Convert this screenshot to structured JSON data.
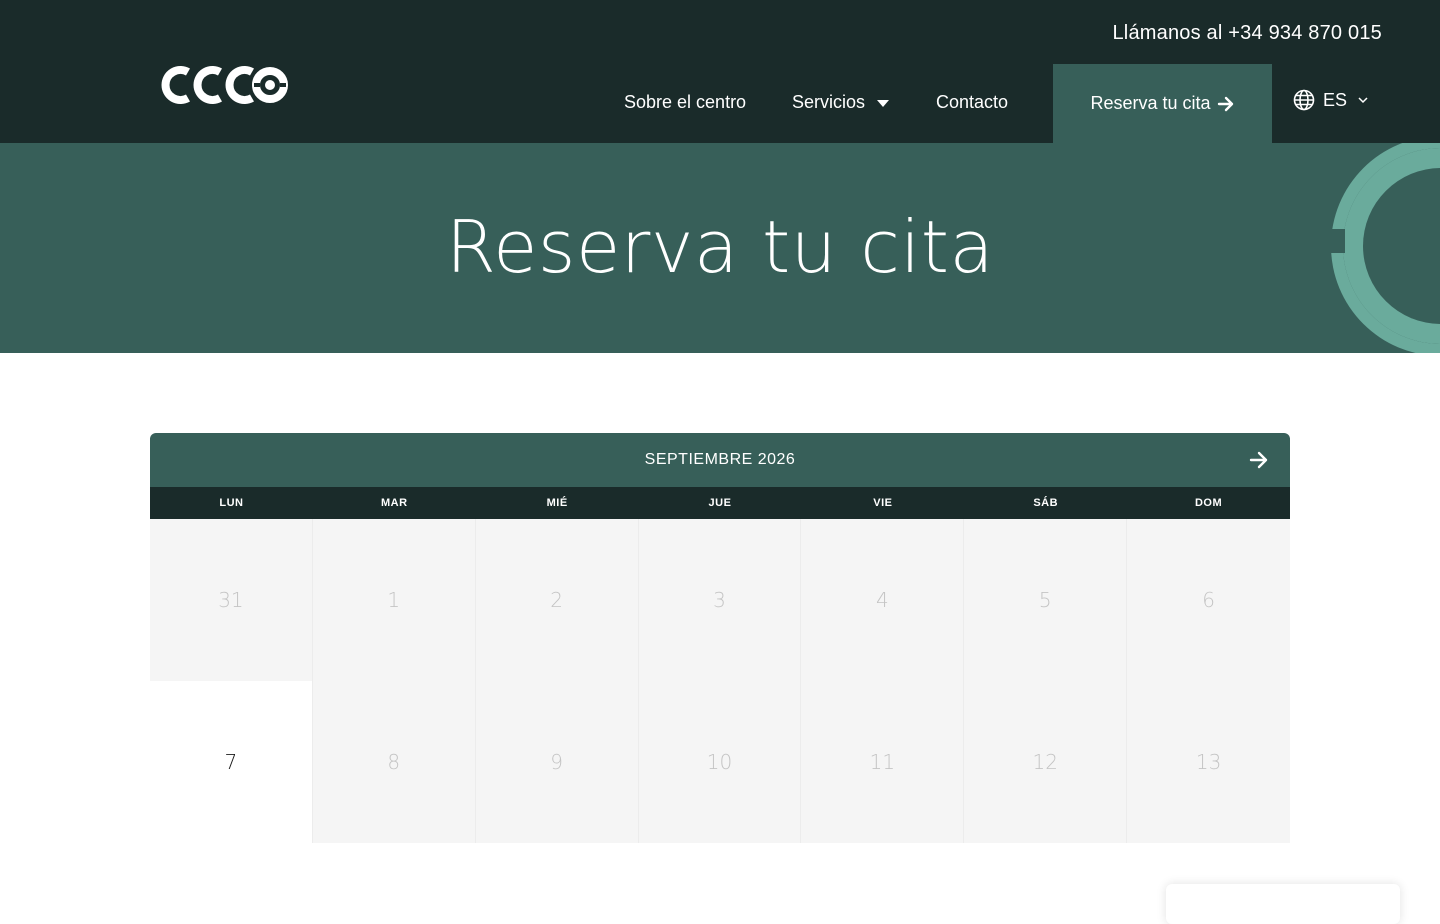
{
  "header": {
    "phone_text": "Llámanos al +34 934 870 015",
    "nav": [
      {
        "label": "Sobre el centro"
      },
      {
        "label": "Servicios"
      },
      {
        "label": "Contacto"
      }
    ],
    "cta_label": "Reserva tu cita",
    "language": "ES"
  },
  "hero": {
    "title": "Reserva tu cita"
  },
  "calendar": {
    "month_label": "SEPTIEMBRE 2026",
    "weekdays": [
      "LUN",
      "MAR",
      "MIÉ",
      "JUE",
      "VIE",
      "SÁB",
      "DOM"
    ],
    "weeks": [
      [
        "31",
        "1",
        "2",
        "3",
        "4",
        "5",
        "6"
      ],
      [
        "7",
        "8",
        "9",
        "10",
        "11",
        "12",
        "13"
      ]
    ],
    "available_day": "7"
  },
  "colors": {
    "dark": "#1a2b2a",
    "primary": "#375f59",
    "accent": "#6aab9c"
  },
  "icons": {
    "logo": "ccco-logo",
    "arrow": "arrow-right-icon",
    "globe": "globe-icon",
    "chevron": "chevron-down-icon"
  }
}
